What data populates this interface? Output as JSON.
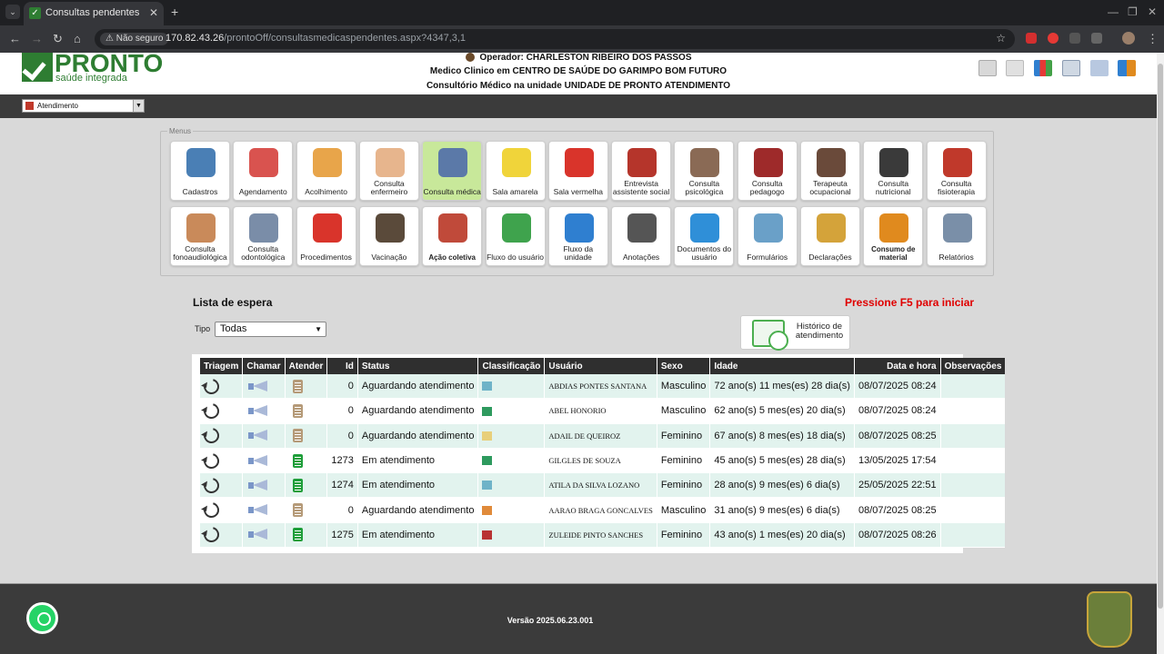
{
  "browser": {
    "tab_title": "Consultas pendentes",
    "security_label": "Não seguro",
    "url_host": "170.82.43.26",
    "url_path": "/prontoOff/consultasmedicaspendentes.aspx?4347,3,1"
  },
  "header": {
    "logo_text": "PRONTO",
    "logo_sub": "saúde integrada",
    "operator": "Operador: CHARLESTON RIBEIRO DOS PASSOS",
    "clinic_line": "Medico Clinico em CENTRO DE SAÚDE DO GARIMPO BOM FUTURO",
    "unit_line": "Consultório Médico na unidade UNIDADE DE PRONTO ATENDIMENTO",
    "unit_select": "Atendimento"
  },
  "menus": {
    "legend": "Menus",
    "row1": [
      {
        "label": "Cadastros",
        "icon": "id-card-icon",
        "color": "#4a7fb5"
      },
      {
        "label": "Agendamento",
        "icon": "calendar-icon",
        "color": "#d9534f"
      },
      {
        "label": "Acolhimento",
        "icon": "nurse-icon",
        "color": "#e8a54a"
      },
      {
        "label": "Consulta enfermeiro",
        "icon": "doctor-male-icon",
        "color": "#e7b58d"
      },
      {
        "label": "Consulta médica",
        "icon": "doctor-icon",
        "color": "#5b79a8",
        "active": true
      },
      {
        "label": "Sala amarela",
        "icon": "bed-yellow-icon",
        "color": "#f0d43a"
      },
      {
        "label": "Sala vermelha",
        "icon": "bed-red-icon",
        "color": "#d9342b"
      },
      {
        "label": "Entrevista assistente social",
        "icon": "social-worker-icon",
        "color": "#b5352b"
      },
      {
        "label": "Consulta psicológica",
        "icon": "psychologist-icon",
        "color": "#8a6a55"
      },
      {
        "label": "Consulta pedagogo",
        "icon": "pedagogue-icon",
        "color": "#9e2a2a"
      },
      {
        "label": "Terapeuta ocupacional",
        "icon": "therapist-icon",
        "color": "#6a4a3a"
      },
      {
        "label": "Consulta nutricional",
        "icon": "nutritionist-icon",
        "color": "#3a3a3a"
      },
      {
        "label": "Consulta fisioterapia",
        "icon": "physio-icon",
        "color": "#c0392b"
      }
    ],
    "row2": [
      {
        "label": "Consulta fonoaudiológica",
        "icon": "speech-therapist-icon",
        "color": "#c98a5a"
      },
      {
        "label": "Consulta odontológica",
        "icon": "dentist-icon",
        "color": "#7a8da8"
      },
      {
        "label": "Procedimentos",
        "icon": "first-aid-kit-icon",
        "color": "#d9342b"
      },
      {
        "label": "Vacinação",
        "icon": "vaccine-nurse-icon",
        "color": "#5a4a3a"
      },
      {
        "label": "Ação coletiva",
        "icon": "group-icon",
        "color": "#c04a3a",
        "bold": true
      },
      {
        "label": "Fluxo do usuário",
        "icon": "user-flow-icon",
        "color": "#3fa34d"
      },
      {
        "label": "Fluxo da unidade",
        "icon": "unit-flow-icon",
        "color": "#2f7fd0"
      },
      {
        "label": "Anotações",
        "icon": "notes-icon",
        "color": "#555555"
      },
      {
        "label": "Documentos do usuário",
        "icon": "folder-icon",
        "color": "#2f8fd8"
      },
      {
        "label": "Formulários",
        "icon": "form-icon",
        "color": "#6aa0c8"
      },
      {
        "label": "Declarações",
        "icon": "declaration-icon",
        "color": "#d4a33a"
      },
      {
        "label": "Consumo de material",
        "icon": "material-box-icon",
        "color": "#e08a1e",
        "bold": true
      },
      {
        "label": "Relatórios",
        "icon": "report-icon",
        "color": "#7a8fa8"
      }
    ]
  },
  "waitlist": {
    "title": "Lista de espera",
    "notice": "Pressione F5 para iniciar",
    "tipo_label": "Tipo",
    "tipo_value": "Todas",
    "history_button": "Histórico de atendimento",
    "columns": [
      "Triagem",
      "Chamar",
      "Atender",
      "Id",
      "Status",
      "Classificação",
      "Usuário",
      "Sexo",
      "Idade",
      "Data e hora",
      "Observações"
    ],
    "rows": [
      {
        "id": "0",
        "status": "Aguardando atendimento",
        "class_color": "#6fb3c8",
        "user": "ABDIAS PONTES SANTANA",
        "sex": "Masculino",
        "age": "72 ano(s) 11 mes(es) 28 dia(s)",
        "datetime": "08/07/2025 08:24",
        "obs": "",
        "attend_color": "#b59a78"
      },
      {
        "id": "0",
        "status": "Aguardando atendimento",
        "class_color": "#2e9a5e",
        "user": "ABEL HONORIO",
        "sex": "Masculino",
        "age": "62 ano(s) 5 mes(es) 20 dia(s)",
        "datetime": "08/07/2025 08:24",
        "obs": "",
        "attend_color": "#b59a78"
      },
      {
        "id": "0",
        "status": "Aguardando atendimento",
        "class_color": "#e8cf7a",
        "user": "ADAIL DE QUEIROZ",
        "sex": "Feminino",
        "age": "67 ano(s) 8 mes(es) 18 dia(s)",
        "datetime": "08/07/2025 08:25",
        "obs": "",
        "attend_color": "#b59a78"
      },
      {
        "id": "1273",
        "status": "Em atendimento",
        "class_color": "#2e9a5e",
        "user": "GILGLES DE SOUZA",
        "sex": "Feminino",
        "age": "45 ano(s) 5 mes(es) 28 dia(s)",
        "datetime": "13/05/2025 17:54",
        "obs": "",
        "attend_color": "#1e9e3a"
      },
      {
        "id": "1274",
        "status": "Em atendimento",
        "class_color": "#6fb3c8",
        "user": "ATILA DA SILVA LOZANO",
        "sex": "Feminino",
        "age": "28 ano(s) 9 mes(es) 6 dia(s)",
        "datetime": "25/05/2025 22:51",
        "obs": "",
        "attend_color": "#1e9e3a"
      },
      {
        "id": "0",
        "status": "Aguardando atendimento",
        "class_color": "#e08a3a",
        "user": "AARAO BRAGA GONCALVES",
        "sex": "Masculino",
        "age": "31 ano(s) 9 mes(es) 6 dia(s)",
        "datetime": "08/07/2025 08:25",
        "obs": "",
        "attend_color": "#b59a78"
      },
      {
        "id": "1275",
        "status": "Em atendimento",
        "class_color": "#b83232",
        "user": "ZULEIDE PINTO SANCHES",
        "sex": "Feminino",
        "age": "43 ano(s) 1 mes(es) 20 dia(s)",
        "datetime": "08/07/2025 08:26",
        "obs": "",
        "attend_color": "#1e9e3a"
      }
    ]
  },
  "footer": {
    "version": "Versão 2025.06.23.001"
  }
}
